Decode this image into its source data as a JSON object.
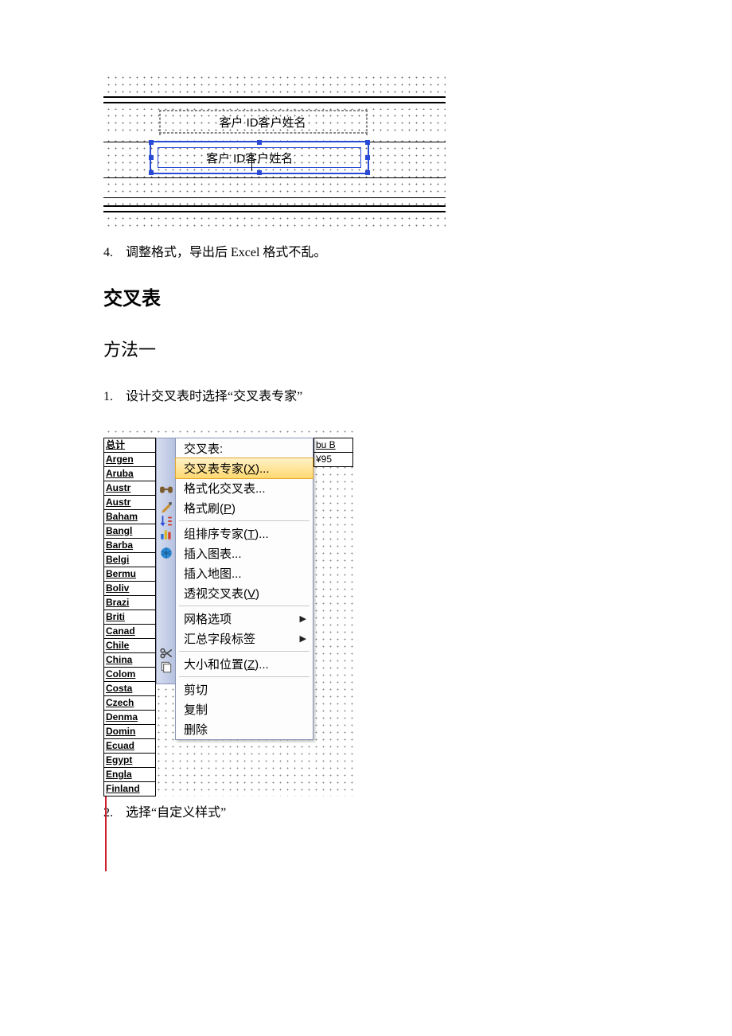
{
  "designer": {
    "field1_label": "客户 ID客户姓名",
    "field2_label": "客户 ID客户姓名"
  },
  "caption1": {
    "num": "4.",
    "text": "调整格式，导出后 Excel 格式不乱。"
  },
  "heading_crosstab": "交叉表",
  "heading_method1": "方法一",
  "caption2": {
    "num": "1.",
    "text": "设计交叉表时选择“交叉表专家”"
  },
  "crosstab": {
    "total_label": "总计",
    "corner_top": "bu B",
    "corner_val": "¥95",
    "countries": [
      "Argen",
      "Aruba",
      "Austr",
      "Austr",
      "Baham",
      "Bangl",
      "Barba",
      "Belgi",
      "Bermu",
      "Boliv",
      "Brazi",
      "Briti",
      "Canad",
      "Chile",
      "China",
      "Colom",
      "Costa",
      "Czech",
      "Denma",
      "Domin",
      "Ecuad",
      "Egypt",
      "Engla",
      "Finland"
    ]
  },
  "menu": {
    "title": "交叉表:",
    "items": [
      {
        "label": "交叉表专家(X)...",
        "hover": true
      },
      {
        "label": "格式化交叉表..."
      },
      {
        "label": "格式刷(P)"
      },
      {
        "sep": true
      },
      {
        "label": "组排序专家(T)..."
      },
      {
        "label": "插入图表..."
      },
      {
        "label": "插入地图..."
      },
      {
        "label": "透视交叉表(V)"
      },
      {
        "sep": true
      },
      {
        "label": "网格选项",
        "submenu": true
      },
      {
        "label": "汇总字段标签",
        "submenu": true
      },
      {
        "sep": true
      },
      {
        "label": "大小和位置(Z)..."
      },
      {
        "sep": true
      },
      {
        "label": "剪切"
      },
      {
        "label": "复制"
      },
      {
        "label": "删除"
      }
    ],
    "icons": [
      "",
      "",
      "binoculars-icon",
      "paintbrush-icon",
      "sort-icon",
      "chart-icon",
      "globe-icon",
      "",
      "",
      "",
      "",
      "",
      "scissors-icon",
      "copy-icon",
      ""
    ]
  },
  "caption3": {
    "num": "2.",
    "text": "选择“自定义样式”"
  }
}
